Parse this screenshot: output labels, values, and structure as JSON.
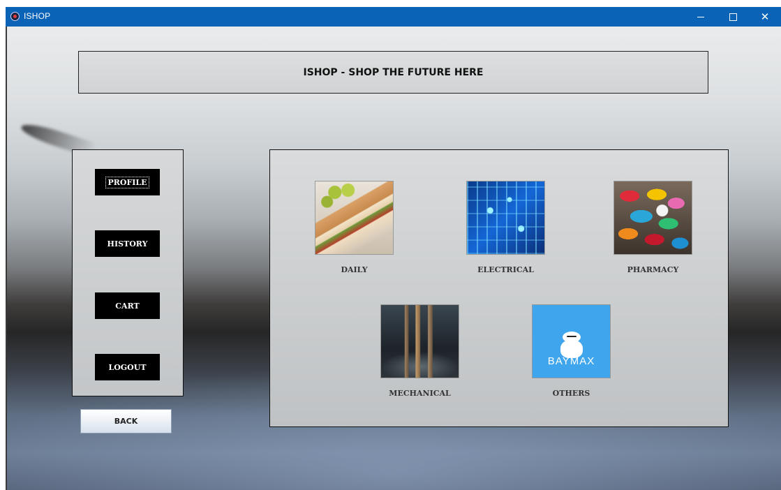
{
  "window": {
    "title": "ISHOP",
    "controls": [
      "minimize",
      "maximize",
      "close"
    ],
    "close_glyph": "✕"
  },
  "banner": {
    "text": "ISHOP - SHOP THE FUTURE HERE"
  },
  "sidebar": {
    "items": [
      {
        "label": "PROFILE",
        "icon": null
      },
      {
        "label": "HISTORY",
        "icon": null
      },
      {
        "label": "CART",
        "icon": null
      },
      {
        "label": "LOGOUT",
        "icon": null
      }
    ],
    "focused": "PROFILE"
  },
  "back_button": {
    "label": "BACK"
  },
  "categories": [
    {
      "label": "DAILY",
      "image": "sandwich-photo"
    },
    {
      "label": "ELECTRICAL",
      "image": "circuit-board-photo"
    },
    {
      "label": "PHARMACY",
      "image": "pills-photo"
    },
    {
      "label": "MECHANICAL",
      "image": "mechanical-city-photo"
    },
    {
      "label": "OTHERS",
      "image": "baymax-logo",
      "logo_text": "BAYMAX"
    }
  ],
  "colors": {
    "titlebar": "#0a63b7",
    "sidebar_button": "#000000",
    "logo_background": "#3fa6ee"
  }
}
